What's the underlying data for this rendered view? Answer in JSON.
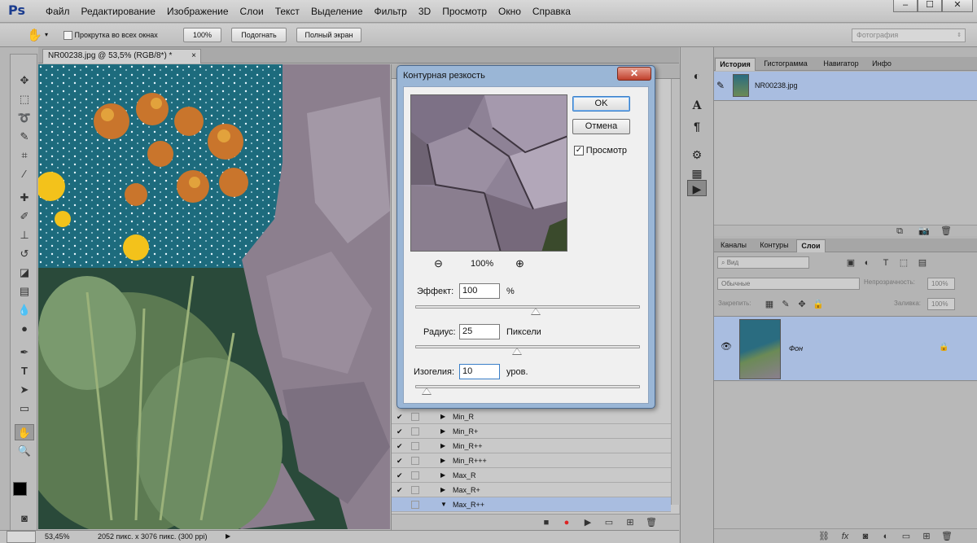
{
  "menubar": {
    "logo": "Ps",
    "items": [
      "Файл",
      "Редактирование",
      "Изображение",
      "Слои",
      "Текст",
      "Выделение",
      "Фильтр",
      "3D",
      "Просмотр",
      "Окно",
      "Справка"
    ]
  },
  "options": {
    "scroll_all_label": "Прокрутка во всех окнах",
    "btn_100": "100%",
    "btn_fit": "Подогнать",
    "btn_fullscreen": "Полный экран",
    "workspace": "Фотография"
  },
  "document": {
    "tab_title": "NR00238.jpg @ 53,5% (RGB/8*) *",
    "zoom": "53,45%",
    "info": "2052 пикс. x 3076 пикс. (300 ppi)"
  },
  "actions": {
    "items": [
      "Min_R",
      "Min_R+",
      "Min_R++",
      "Min_R+++",
      "Max_R",
      "Max_R+",
      "Max_R++"
    ]
  },
  "dialog": {
    "title": "Контурная резкость",
    "ok": "OK",
    "cancel": "Отмена",
    "preview_label": "Просмотр",
    "preview_checked": true,
    "zoom": "100%",
    "amount_label": "Эффект:",
    "amount_value": "100",
    "amount_unit": "%",
    "radius_label": "Радиус:",
    "radius_value": "25",
    "radius_unit": "Пиксели",
    "threshold_label": "Изогелия:",
    "threshold_value": "10",
    "threshold_unit": "уров."
  },
  "history_panel": {
    "tabs": [
      "История",
      "Гистограмма",
      "Навигатор",
      "Инфо"
    ],
    "state": "NR00238.jpg"
  },
  "layers_panel": {
    "tabs": [
      "Каналы",
      "Контуры",
      "Слои"
    ],
    "filter_placeholder": "Вид",
    "blend_mode": "Обычные",
    "opacity_label": "Непрозрачность:",
    "opacity_value": "100%",
    "lock_label": "Закрепить:",
    "fill_label": "Заливка:",
    "fill_value": "100%",
    "layer_name": "Фон"
  }
}
